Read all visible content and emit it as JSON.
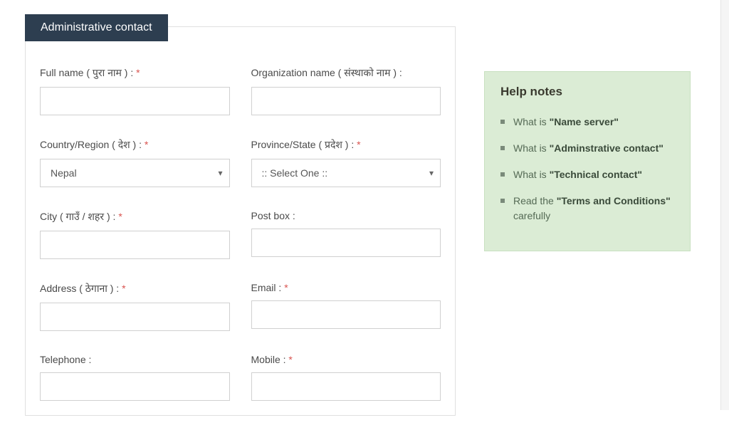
{
  "section": {
    "title": "Administrative contact"
  },
  "form": {
    "fullname": {
      "label": "Full name ( पुरा नाम ) : ",
      "required": true
    },
    "orgname": {
      "label": "Organization name ( संस्थाको नाम ) :",
      "required": false
    },
    "country": {
      "label": "Country/Region ( देश ) : ",
      "required": true,
      "value": "Nepal"
    },
    "province": {
      "label": "Province/State ( प्रदेश ) : ",
      "required": true,
      "value": ":: Select One ::"
    },
    "city": {
      "label": "City ( गाउँ / शहर ) : ",
      "required": true
    },
    "postbox": {
      "label": "Post box :",
      "required": false
    },
    "address": {
      "label": "Address ( ठेगाना ) : ",
      "required": true
    },
    "email": {
      "label": "Email : ",
      "required": true
    },
    "telephone": {
      "label": "Telephone :",
      "required": false
    },
    "mobile": {
      "label": "Mobile : ",
      "required": true
    }
  },
  "required_mark": "*",
  "help": {
    "title": "Help notes",
    "items": [
      {
        "prefix": "What is ",
        "bold": "\"Name server\"",
        "suffix": ""
      },
      {
        "prefix": "What is ",
        "bold": "\"Adminstrative contact\"",
        "suffix": ""
      },
      {
        "prefix": "What is ",
        "bold": "\"Technical contact\"",
        "suffix": ""
      },
      {
        "prefix": "Read the ",
        "bold": "\"Terms and Conditions\"",
        "suffix": " carefully"
      }
    ]
  }
}
